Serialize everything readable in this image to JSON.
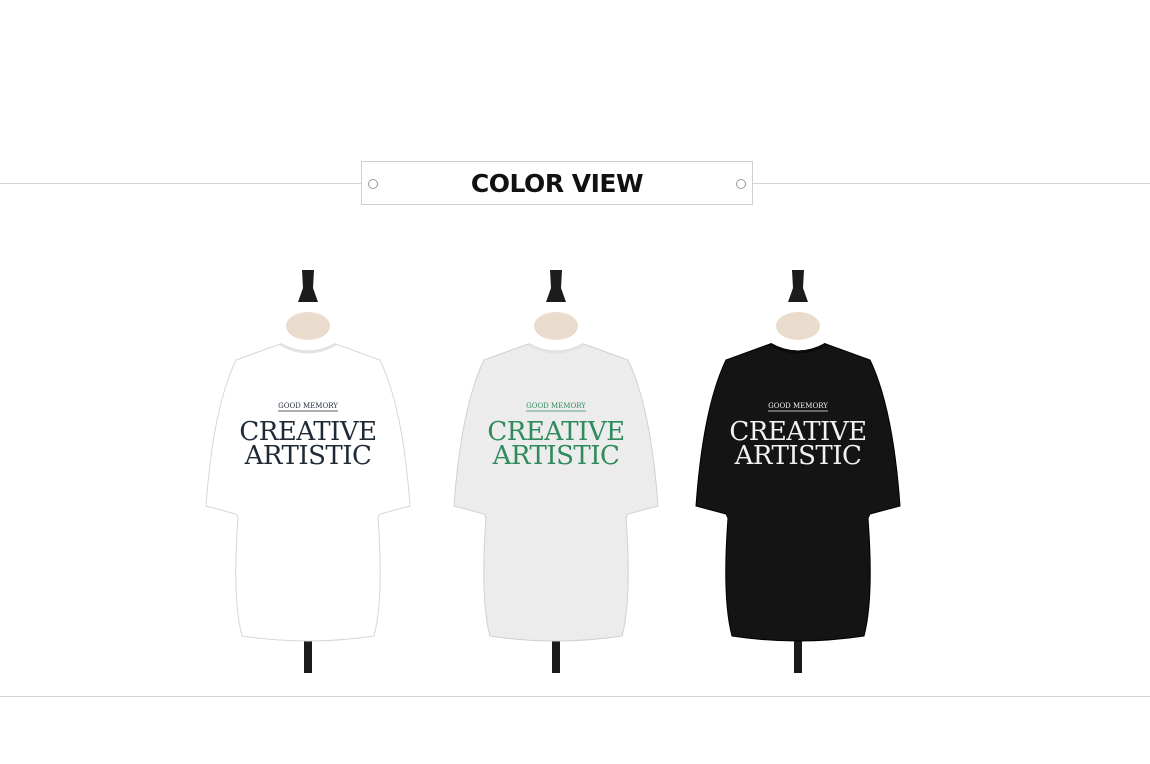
{
  "section": {
    "title": "COLOR VIEW"
  },
  "products": [
    {
      "color": "white",
      "shirt_color": "#ffffff",
      "print_color": "#1f2a36",
      "line1": "GOOD MEMORY",
      "line2": "CREATIVE",
      "line3": "ARTISTIC"
    },
    {
      "color": "melange",
      "shirt_color": "#ececec",
      "print_color": "#2f8a5c",
      "line1": "GOOD MEMORY",
      "line2": "CREATIVE",
      "line3": "ARTISTIC"
    },
    {
      "color": "black",
      "shirt_color": "#141414",
      "print_color": "#f2f2f2",
      "line1": "GOOD MEMORY",
      "line2": "CREATIVE",
      "line3": "ARTISTIC"
    }
  ]
}
